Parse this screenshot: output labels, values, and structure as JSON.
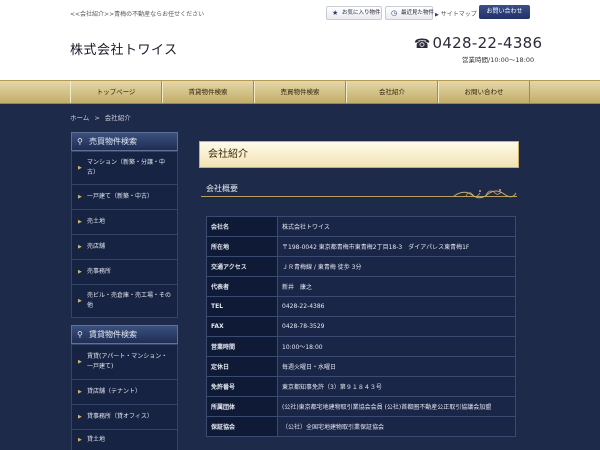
{
  "header": {
    "tagline": "<<会社紹介>>青梅の不動産ならお任せください",
    "logo": "株式会社トワイス",
    "favorites_label": "お気に入り物件",
    "recent_label": "最近見た物件",
    "sitemap_label": "サイトマップ",
    "contact_label": "お問い合わせ",
    "phone": "0428-22-4386",
    "hours": "営業時間/10:00～18:00"
  },
  "nav": [
    {
      "label": "トップページ"
    },
    {
      "label": "賃貸物件検索"
    },
    {
      "label": "売買物件検索"
    },
    {
      "label": "会社紹介"
    },
    {
      "label": "お問い合わせ"
    }
  ],
  "breadcrumb": {
    "home": "ホーム",
    "separator": ">",
    "current": "会社紹介"
  },
  "sidebar": {
    "sale": {
      "title": "売買物件検索",
      "items": [
        "マンション（新築・分譲・中古）",
        "一戸建て（新築・中古）",
        "売土地",
        "売店舗",
        "売事務所",
        "売ビル・売倉庫・売工場・その他"
      ]
    },
    "rent": {
      "title": "賃貸物件検索",
      "items": [
        "賃貸(アパート・マンション・一戸建て)",
        "貸店舗（テナント）",
        "貸事務所（貸オフィス）",
        "貸土地"
      ]
    }
  },
  "main": {
    "title": "会社紹介",
    "section": "会社概要",
    "rows": [
      {
        "key": "会社名",
        "value": "株式会社トワイス"
      },
      {
        "key": "所在地",
        "value": "〒198-0042 東京都青梅市東青梅2丁目18-3　ダイアパレス東青梅1F"
      },
      {
        "key": "交通アクセス",
        "value": "ＪＲ青梅線 / 東青梅 徒歩 3分"
      },
      {
        "key": "代表者",
        "value": "新井　康之"
      },
      {
        "key": "TEL",
        "value": "0428-22-4386"
      },
      {
        "key": "FAX",
        "value": "0428-78-3529"
      },
      {
        "key": "営業時間",
        "value": "10:00～18:00"
      },
      {
        "key": "定休日",
        "value": "毎週火曜日・水曜日"
      },
      {
        "key": "免許番号",
        "value": "東京都知事免許（3）第９１８４３号"
      },
      {
        "key": "所属団体",
        "value": "(公社)東京都宅地建物取引業協会会員 (公社)首都圏不動産公正取引協議会加盟"
      },
      {
        "key": "保証協会",
        "value": "（公社）全国宅地建物取引業保証協会"
      }
    ]
  },
  "colors": {
    "accent_gold": "#c9b06a",
    "navy": "#1e2a4a",
    "button_blue": "#2d3d6a"
  }
}
